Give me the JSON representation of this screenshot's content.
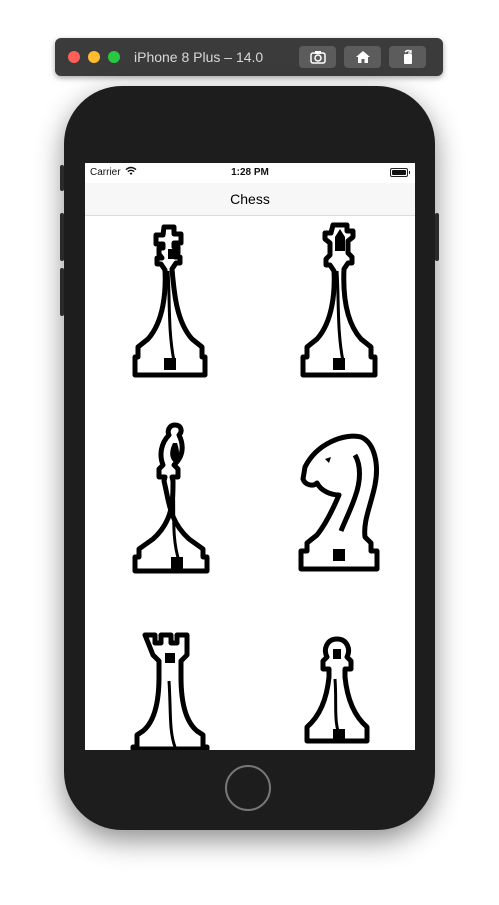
{
  "simulator": {
    "title": "iPhone 8 Plus – 14.0",
    "buttons": [
      "screenshot-icon",
      "home-icon",
      "rotate-icon"
    ]
  },
  "status_bar": {
    "carrier": "Carrier",
    "time": "1:28 PM"
  },
  "nav": {
    "title": "Chess"
  },
  "grid": {
    "items": [
      {
        "piece": "king",
        "icon": "chess-king-icon"
      },
      {
        "piece": "queen",
        "icon": "chess-queen-icon"
      },
      {
        "piece": "bishop",
        "icon": "chess-bishop-icon"
      },
      {
        "piece": "knight",
        "icon": "chess-knight-icon"
      },
      {
        "piece": "rook",
        "icon": "chess-rook-icon"
      },
      {
        "piece": "pawn",
        "icon": "chess-pawn-icon"
      }
    ]
  }
}
